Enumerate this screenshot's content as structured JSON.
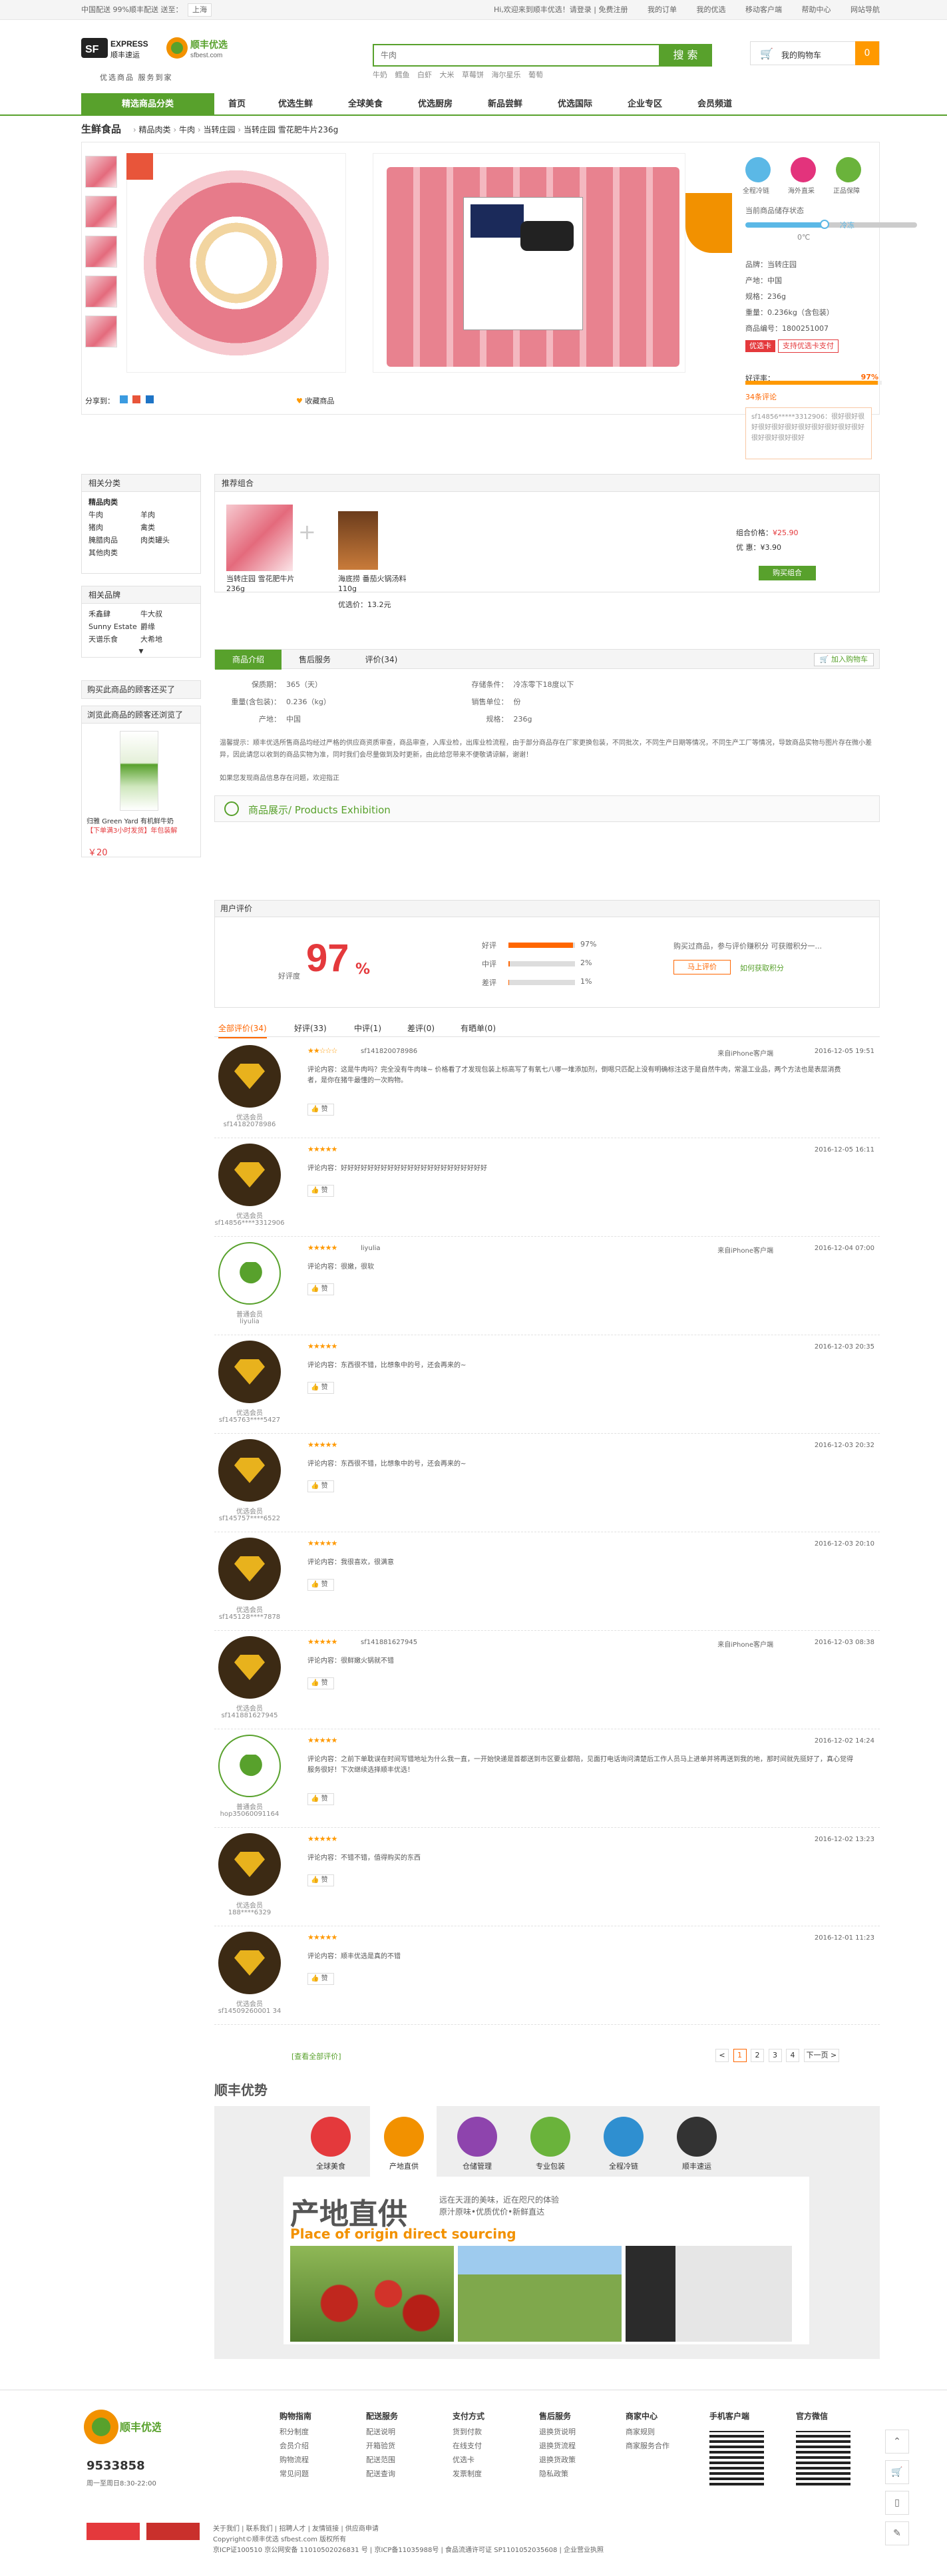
{
  "topbar": {
    "welcome": "Hi,欢迎来到顺丰优选！请登录 | 免费注册",
    "left_text": "中国配送 99%顺丰配送 送至：",
    "location": "上海",
    "links": [
      "我的订单",
      "我的优选",
      "移动客户端",
      "帮助中心",
      "网站导航"
    ]
  },
  "header": {
    "logo_sf": "SF EXPRESS 顺丰速运",
    "logo_best": "顺丰优选 sfbest.com",
    "slogan": "优选商品  服务到家",
    "search_placeholder": "牛肉",
    "search_btn": "搜 索",
    "hot_words": [
      "牛奶",
      "鳕鱼",
      "白虾",
      "大米",
      "草莓饼",
      "海尔星乐",
      "葡萄"
    ],
    "cart_label": "我的购物车",
    "cart_count": "0"
  },
  "nav": {
    "category": "精选商品分类",
    "items": [
      "首页",
      "优选生鲜",
      "全球美食",
      "优选厨房",
      "新品尝鲜",
      "优选国际",
      "企业专区",
      "会员频道"
    ]
  },
  "breadcrumb": {
    "head": "生鲜食品",
    "items": [
      "精品肉类",
      "牛肉",
      "当转庄园",
      "当转庄园 雪花肥牛片236g"
    ]
  },
  "product": {
    "service": [
      "全程冷链",
      "海外直采",
      "正品保障"
    ],
    "storage_label": "当前商品储存状态",
    "storage_mode": "冷冻",
    "temp": "0℃",
    "specs": [
      "品牌：当转庄园",
      "产地：中国",
      "规格：236g",
      "重量：0.236kg（含包装）",
      "商品编号：1800251007"
    ],
    "promo_tag": "优选卡",
    "promo_text": "支持优选卡支付",
    "good_label": "好评率：",
    "good_rate": "97%",
    "review_count": "34条评论",
    "quote": "sf14856*****3312906：很好很好很好很好很好很好很好很好很好很好很好很好很好很好很好",
    "share": "分享到：",
    "fav": "收藏商品"
  },
  "sidebar": {
    "cat_title": "相关分类",
    "cat_head": "精品肉类",
    "cats": [
      "牛肉",
      "羊肉",
      "猪肉",
      "禽类",
      "腌腊肉品",
      "肉类罐头",
      "其他肉类"
    ],
    "brand_title": "相关品牌",
    "brands": [
      "禾鑫肆",
      "牛大叔",
      "Sunny Estate",
      "爵缘",
      "天谱乐食",
      "大希地"
    ],
    "ask": "购买此商品的顾客还买了",
    "view": "浏览此商品的顾客还浏览了",
    "view_item": "归雅 Green Yard 有机鲜牛奶",
    "view_promo": "【下单满3小时发货】年包装解",
    "view_price": "￥20"
  },
  "recommend": {
    "title": "推荐组合",
    "item1": "当转庄园 雪花肥牛片236g",
    "item2": "海底捞 番茄火锅汤料 110g",
    "item2_price": "优选价：13.2元",
    "sum_label": "组合价格：",
    "sum_price": "¥25.90",
    "save_label": "优  惠：",
    "save_price": "¥3.90",
    "buy": "购买组合"
  },
  "tabs": [
    "商品介绍",
    "售后服务",
    "评价(34)"
  ],
  "add_cart": "加入购物车",
  "attrs": [
    [
      "保质期：",
      "365（天）",
      "存储条件：",
      "冷冻零下18度以下"
    ],
    [
      "重量(含包装)：",
      "0.236（kg）",
      "销售单位：",
      "份"
    ],
    [
      "产地：",
      "中国",
      "规格：",
      "236g"
    ]
  ],
  "tips_label": "温馨提示：",
  "tips": "顺丰优选所售商品均经过严格的供应商资质审查，商品审查，入库业检，出库业检流程，由于部分商品存在厂家更换包装，不同批次，不同生产日期等情况，不同生产工厂等情况，导致商品实物与图片存在微小差异，因此请您以收到的商品实物为准，同时我们会尽量做到及时更新，由此给您带来不便敬请谅解，谢谢！",
  "tips2": "如果您发现商品信息存在问题，欢迎指正",
  "exhibit": "商品展示/ Products Exhibition",
  "reviews": {
    "title": "用户评价",
    "rate_label": "好评度",
    "rate": "97",
    "bars": [
      {
        "label": "好评",
        "value": 97,
        "text": "97%"
      },
      {
        "label": "中评",
        "value": 2,
        "text": "2%"
      },
      {
        "label": "差评",
        "value": 1,
        "text": "1%"
      }
    ],
    "prompt": "购买过商品，参与评价赚积分 可获赠积分一...",
    "btn": "马上评价",
    "link": "如何获取积分",
    "tabs": [
      "全部评价(34)",
      "好评(33)",
      "中评(1)",
      "差评(0)",
      "有晒单(0)"
    ],
    "items": [
      {
        "level": "优选会员",
        "name": "sf14182078986",
        "user": "sf141820078986",
        "src": "来自iPhone客户端",
        "date": "2016-12-05 19:51",
        "text": "评论内容：这是牛肉吗？完全没有牛肉味~ 价格看了才发现包装上标高写了有氧七八哪一堆添加剂，倒嗯只匹配上没有明确标注这于是自然牛肉，常温工业品，两个方法也是表层消费者，是你在猪牛最懂的一次购物。",
        "stars": "★★☆☆☆",
        "gold": true
      },
      {
        "level": "优选会员",
        "name": "sf14856****3312906",
        "user": "",
        "src": "",
        "date": "2016-12-05 16:11",
        "text": "评论内容：好好好好好好好好好好好好好好好好好好好好好好",
        "stars": "★★★★★",
        "gold": true
      },
      {
        "level": "普通会员",
        "name": "liyulia",
        "user": "liyulia",
        "src": "来自iPhone客户端",
        "date": "2016-12-04 07:00",
        "text": "评论内容：很嫩，很软",
        "stars": "★★★★★",
        "gold": false
      },
      {
        "level": "优选会员",
        "name": "sf145763****5427",
        "user": "",
        "src": "",
        "date": "2016-12-03 20:35",
        "text": "评论内容：东西很不错，比想象中的号，还会再来的~",
        "stars": "★★★★★",
        "gold": true
      },
      {
        "level": "优选会员",
        "name": "sf145757****6522",
        "user": "",
        "src": "",
        "date": "2016-12-03 20:32",
        "text": "评论内容：东西很不错，比想象中的号，还会再来的~",
        "stars": "★★★★★",
        "gold": true
      },
      {
        "level": "优选会员",
        "name": "sf145128****7878",
        "user": "",
        "src": "",
        "date": "2016-12-03 20:10",
        "text": "评论内容：我很喜欢，很满意",
        "stars": "★★★★★",
        "gold": true
      },
      {
        "level": "优选会员",
        "name": "sf141881627945",
        "user": "sf141881627945",
        "src": "来自iPhone客户端",
        "date": "2016-12-03 08:38",
        "text": "评论内容：很鲜嫩火锅就不错",
        "stars": "★★★★★",
        "gold": true
      },
      {
        "level": "普通会员",
        "name": "hop35060091164",
        "user": "",
        "src": "",
        "date": "2016-12-02 14:24",
        "text": "评论内容：之前下单耽误在时间写错地址为什么我一直，一开始快递是首都送到市区要业都陪，见面打电话询问清楚后工作人员马上进单并将再送到我的地，那时间就先挺好了，真心觉得服务很好！下次继续选择顺丰优选！",
        "stars": "★★★★★",
        "gold": false
      },
      {
        "level": "优选会员",
        "name": "188****6329",
        "user": "",
        "src": "",
        "date": "2016-12-02 13:23",
        "text": "评论内容：不错不错，值得购买的东西",
        "stars": "★★★★★",
        "gold": true
      },
      {
        "level": "优选会员",
        "name": "sf14509260001 34",
        "user": "",
        "src": "",
        "date": "2016-12-01 11:23",
        "text": "评论内容：顺丰优选是真的不错",
        "stars": "★★★★★",
        "gold": true
      }
    ],
    "zan": "赞",
    "all": "[查看全部评价]",
    "pages": [
      "<",
      "1",
      "2",
      "3",
      "4",
      "下一页 >"
    ]
  },
  "advantage": {
    "title": "顺丰优势",
    "items": [
      "全球美食",
      "产地直供",
      "仓储管理",
      "专业包装",
      "全程冷链",
      "顺丰速运"
    ],
    "colors": [
      "#e4393c",
      "#f29100",
      "#8e44ad",
      "#6ab33b",
      "#2f8fd0",
      "#333333"
    ],
    "big": "产地直供",
    "desc1": "远在天涯的美味，近在咫尺的体验",
    "desc2": "原汁原味•优质优价•新鲜直达",
    "en": "Place of origin direct sourcing"
  },
  "footer": {
    "phone": "9533858",
    "hours": "周一至周日8:30-22:00",
    "cols": [
      {
        "t": "购物指南",
        "i": [
          "积分制度",
          "会员介绍",
          "购物流程",
          "常见问题"
        ]
      },
      {
        "t": "配送服务",
        "i": [
          "配送说明",
          "开箱验货",
          "配送范围",
          "配送查询"
        ]
      },
      {
        "t": "支付方式",
        "i": [
          "货到付款",
          "在线支付",
          "优选卡",
          "发票制度"
        ]
      },
      {
        "t": "售后服务",
        "i": [
          "退换货说明",
          "退换货流程",
          "退换货政策",
          "隐私政策"
        ]
      },
      {
        "t": "商家中心",
        "i": [
          "商家规则",
          "商家服务合作"
        ]
      },
      {
        "t": "手机客户端",
        "i": []
      },
      {
        "t": "官方微信",
        "i": []
      }
    ],
    "links": "关于我们 | 联系我们 | 招聘人才 | 友情链接 | 供应商申请",
    "copy": "Copyright©顺丰优选 sfbest.com 版权所有",
    "icp": "京ICP证100510 京公网安备 11010502026831 号 | 京ICP备11035988号 | 食品流通许可证 SP1101052035608 | 企业营业执照"
  }
}
